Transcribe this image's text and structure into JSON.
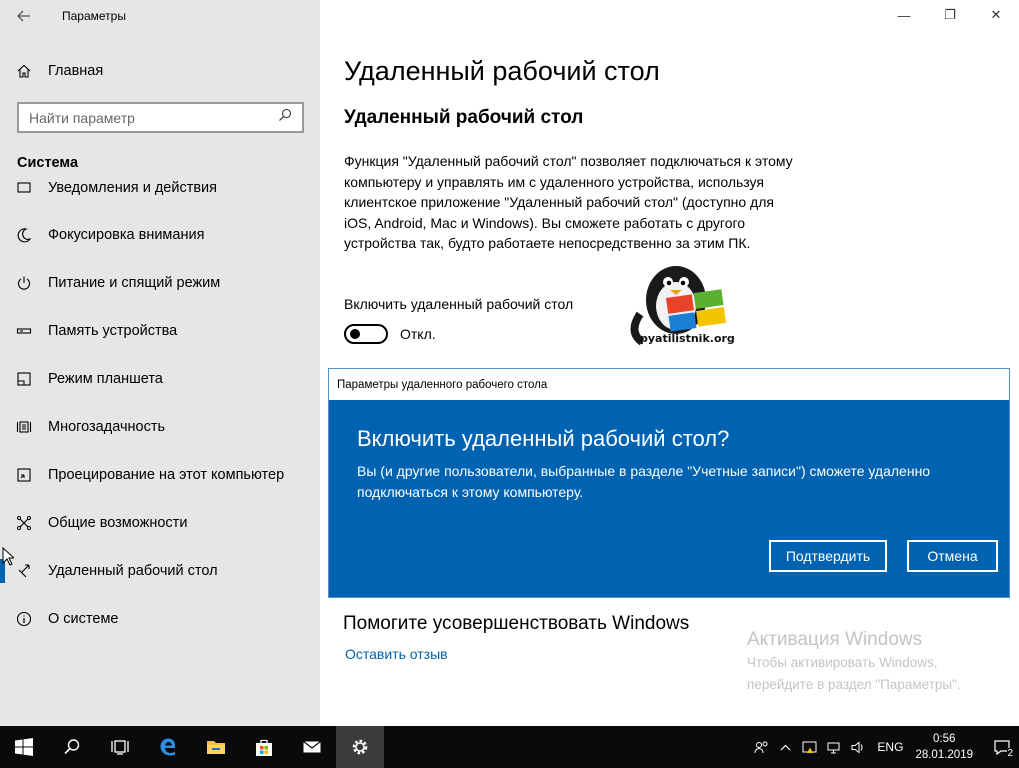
{
  "window": {
    "app_title": "Параметры",
    "controls": {
      "minimize": "—",
      "restore": "❐",
      "close": "✕"
    }
  },
  "sidebar": {
    "home_label": "Главная",
    "search_placeholder": "Найти параметр",
    "section_label": "Система",
    "items": [
      {
        "label": "Уведомления и действия",
        "icon": "notifications-icon"
      },
      {
        "label": "Фокусировка внимания",
        "icon": "focus-assist-icon"
      },
      {
        "label": "Питание и спящий режим",
        "icon": "power-icon"
      },
      {
        "label": "Память устройства",
        "icon": "storage-icon"
      },
      {
        "label": "Режим планшета",
        "icon": "tablet-icon"
      },
      {
        "label": "Многозадачность",
        "icon": "multitasking-icon"
      },
      {
        "label": "Проецирование на этот компьютер",
        "icon": "projecting-icon"
      },
      {
        "label": "Общие возможности",
        "icon": "shared-experiences-icon"
      },
      {
        "label": "Удаленный рабочий стол",
        "icon": "remote-desktop-icon",
        "active": true
      },
      {
        "label": "О системе",
        "icon": "info-icon"
      }
    ]
  },
  "main": {
    "page_title": "Удаленный рабочий стол",
    "section_title": "Удаленный рабочий стол",
    "description": "Функция \"Удаленный рабочий стол\" позволяет подключаться к этому компьютеру и управлять им с удаленного устройства, используя клиентское приложение \"Удаленный рабочий стол\" (доступно для iOS, Android, Mac и Windows). Вы сможете работать с другого устройства так, будто работаете непосредственно за этим ПК.",
    "toggle_label": "Включить удаленный рабочий стол",
    "toggle_state": "Откл.",
    "toggle_on": false,
    "help_title": "Помогите усовершенствовать Windows",
    "feedback_link": "Оставить отзыв"
  },
  "logo": {
    "text": "pyatilistnik.org"
  },
  "watermark": {
    "title": "Активация Windows",
    "line1": "Чтобы активировать Windows,",
    "line2": "перейдите в раздел \"Параметры\"."
  },
  "dialog": {
    "window_title": "Параметры удаленного рабочего стола",
    "heading": "Включить удаленный рабочий стол?",
    "body": "Вы (и другие пользователи, выбранные в разделе \"Учетные записи\") сможете удаленно подключаться к этому компьютеру.",
    "confirm_label": "Подтвердить",
    "cancel_label": "Отмена",
    "accent_color": "#0063b1"
  },
  "taskbar": {
    "language": "ENG",
    "time": "0:56",
    "date": "28.01.2019",
    "notification_count": "2",
    "apps": [
      "start-icon",
      "search-icon",
      "task-view-icon",
      "edge-icon",
      "file-explorer-icon",
      "store-icon",
      "mail-icon",
      "settings-icon"
    ]
  }
}
